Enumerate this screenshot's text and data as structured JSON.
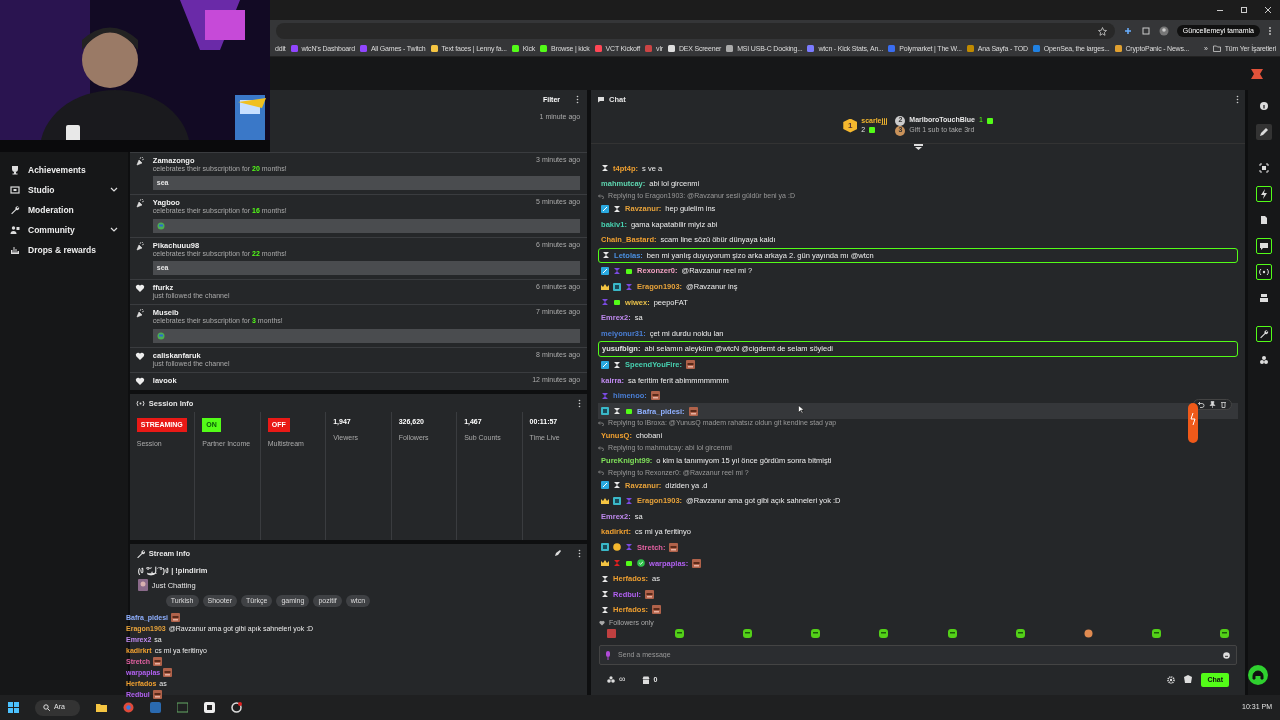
{
  "browser": {
    "update_button": "Güncellemeyi tamamla",
    "bookmarks": [
      "ddit",
      "wtcN's Dashboard",
      "All Games - Twitch",
      "Text faces | Lenny fa...",
      "Kick",
      "Browse | kick",
      "VCT Kickoff",
      "vlr",
      "DEX Screener",
      "MSI USB-C Docking...",
      "wtcn - Kick Stats, An...",
      "Polymarket | The W...",
      "Ana Sayfa - TOD",
      "OpenSea, the larges...",
      "CryptoPanic - News..."
    ],
    "more": "»",
    "all_bookmarks": "Tüm Yer İşaretleri"
  },
  "sidebar": {
    "items": [
      {
        "label": "Achievements",
        "kind": "trophy",
        "expandable": false
      },
      {
        "label": "Studio",
        "kind": "studio",
        "expandable": true
      },
      {
        "label": "Moderation",
        "kind": "wrench",
        "expandable": false
      },
      {
        "label": "Community",
        "kind": "people",
        "expandable": true
      },
      {
        "label": "Drops & rewards",
        "kind": "drops",
        "expandable": false
      }
    ]
  },
  "activity": {
    "filter": "Filter",
    "items": [
      {
        "kind": "hidden",
        "time": "1 minute ago"
      },
      {
        "kind": "subscription",
        "name": "Zamazongo",
        "message": "celebrates their subscription for",
        "months": "20",
        "suffix": "months!",
        "quote": "sea",
        "time": "3 minutes ago"
      },
      {
        "kind": "subscription",
        "name": "Yagboo",
        "message": "celebrates their subscription for",
        "months": "16",
        "suffix": "months!",
        "quote_emote": true,
        "time": "5 minutes ago"
      },
      {
        "kind": "subscription",
        "name": "Pikachuuu98",
        "message": "celebrates their subscription for",
        "months": "22",
        "suffix": "months!",
        "quote": "sea",
        "time": "6 minutes ago"
      },
      {
        "kind": "follow",
        "name": "ffurkz",
        "message": "just followed the channel",
        "time": "6 minutes ago"
      },
      {
        "kind": "subscription",
        "name": "Museib",
        "message": "celebrates their subscription for",
        "months": "3",
        "suffix": "months!",
        "quote_emote": true,
        "time": "7 minutes ago"
      },
      {
        "kind": "follow",
        "name": "caliskanfaruk",
        "message": "just followed the channel",
        "time": "8 minutes ago"
      },
      {
        "kind": "follow",
        "name": "lavook",
        "time": "12 minutes ago"
      }
    ]
  },
  "session_info": {
    "title": "Session Info",
    "stats": [
      {
        "kind": "status",
        "badge": {
          "text": "STREAMING",
          "kind": "live"
        },
        "label": "Session"
      },
      {
        "kind": "status",
        "badge": {
          "text": "ON",
          "kind": "on"
        },
        "label": "Partner Income"
      },
      {
        "kind": "status",
        "badge": {
          "text": "OFF",
          "kind": "off"
        },
        "label": "Multistream"
      },
      {
        "kind": "stat",
        "value": "1,947",
        "label": "Viewers"
      },
      {
        "kind": "stat",
        "value": "326,620",
        "label": "Followers"
      },
      {
        "kind": "stat",
        "value": "1,467",
        "label": "Sub Counts"
      },
      {
        "kind": "stat",
        "value": "00:11:57",
        "label": "Time Live"
      }
    ]
  },
  "stream_info": {
    "title": "Stream Info",
    "stream_title": "(ง ͠° ͟ل͜ ͡°)ง | !pindirim",
    "category": "Just Chatting",
    "tags": [
      "Turkish",
      "Shooter",
      "Türkçe",
      "gaming",
      "pozitif",
      "wtcn"
    ]
  },
  "overlay_chat": [
    {
      "name": "Bafra_pidesi",
      "color": "#8fb0ff",
      "emote": true
    },
    {
      "name": "Eragon1903",
      "color": "#e8a33a",
      "text": "@Ravzanur ama got gibi apık sahneleri yok :D"
    },
    {
      "name": "Emrex2",
      "color": "#c08af0",
      "text": "sa"
    },
    {
      "name": "kadirkrt",
      "color": "#f0a030",
      "text": "cs mi ya feritinyo"
    },
    {
      "name": "Stretch",
      "color": "#e060a0",
      "emote": true
    },
    {
      "name": "warpaplas",
      "color": "#b060f0",
      "emote": true
    },
    {
      "name": "Herfados",
      "color": "#f0a030",
      "text": "as"
    },
    {
      "name": "Redbul",
      "color": "#b060f0",
      "emote": true
    }
  ],
  "chat": {
    "title": "Chat",
    "leaderboard": [
      {
        "kind": "first",
        "rank": "1",
        "name": "scarlejjj",
        "count": "2"
      },
      {
        "kind": "runner",
        "rank": "2",
        "name": "MarlboroTouchBlue",
        "count": "1"
      }
    ],
    "leaderboard_hint": {
      "rank": "3",
      "text": "Gift 1 sub to take 3rd"
    },
    "messages": [
      {
        "badges": [
          {
            "kind": "subscriber"
          }
        ],
        "name": "t4pt4p:",
        "color": "#f0a030",
        "text": "s ve a"
      },
      {
        "name": "mahmutcay:",
        "color": "#5fd6b0",
        "text": "abi lol gircenmi"
      },
      {
        "reply": "Replying to Eragon1903: @Ravzanur sesli güldür beni ya :D",
        "badges": [
          {
            "kind": "moderator"
          },
          {
            "kind": "subscriber"
          }
        ],
        "name": "Ravzanur:",
        "color": "#e8a33a",
        "text": "hep gulelim ins"
      },
      {
        "name": "bakiv1:",
        "color": "#47d1b0",
        "text": "gama kapatabilir miyiz abi"
      },
      {
        "name": "Chain_Bastard:",
        "color": "#f0a030",
        "text": "scam line sözü öbür dünyaya kaldı"
      },
      {
        "highlighted": true,
        "badges": [
          {
            "kind": "subscriber"
          }
        ],
        "name": "Letolas:",
        "color": "#4a90e2",
        "text": "ben mi yanlış duyuyorum şizo arka arkaya 2. gün yayında mı @wtcn"
      },
      {
        "badges": [
          {
            "kind": "moderator"
          },
          {
            "kind": "tier2"
          },
          {
            "kind": "gifter"
          }
        ],
        "name": "Rexonzer0:",
        "color": "#f0a0c0",
        "text": "@Ravzanur reel mi ?"
      },
      {
        "badges": [
          {
            "kind": "founder"
          },
          {
            "kind": "vip"
          },
          {
            "kind": "tier2"
          }
        ],
        "name": "Eragon1903:",
        "color": "#e8a33a",
        "text": "@Ravzanur inş"
      },
      {
        "badges": [
          {
            "kind": "tier2"
          },
          {
            "kind": "gifter"
          }
        ],
        "name": "wiwex:",
        "color": "#e8c04a",
        "text": "peepoFAT"
      },
      {
        "name": "Emrex2:",
        "color": "#c08af0",
        "text": "sa"
      },
      {
        "name": "meiyonur31:",
        "color": "#4a7fd6",
        "text": "çet mi durdu noldu lan"
      },
      {
        "highlighted": true,
        "name": "yusufblgn:",
        "color": "#e0e0e0",
        "text": "abi selamın aleyküm @wtcN @cigdemt de selam söyledi"
      },
      {
        "badges": [
          {
            "kind": "moderator"
          },
          {
            "kind": "subscriber"
          }
        ],
        "name": "SpeendYouFire:",
        "color": "#47d1b0",
        "emote": true
      },
      {
        "name": "kairra:",
        "color": "#c08af0",
        "text": "sa feritim ferit abimmmmmmm"
      },
      {
        "badges": [
          {
            "kind": "tier2"
          }
        ],
        "name": "himenoo:",
        "color": "#4a7fd6",
        "emote": true
      },
      {
        "hovered": true,
        "badges": [
          {
            "kind": "vip"
          },
          {
            "kind": "subscriber"
          },
          {
            "kind": "gifter"
          }
        ],
        "name": "Bafra_pidesi:",
        "color": "#8fb0ff",
        "emote": true
      },
      {
        "reply": "Replying to lBroxa: @YunusQ madem rahatsız oldun git kendine stad yap",
        "name": "YunusQ:",
        "color": "#f0a030",
        "text": "chobani"
      },
      {
        "reply": "Replying to mahmutcay: abi lol gircenmi",
        "name": "PureKnight99:",
        "color": "#7fe05a",
        "text": "o kim la tanımıyom 15 yıl önce gördüm sonra bitmişti"
      },
      {
        "reply": "Replying to Rexonzer0: @Ravzanur reel mi ?",
        "badges": [
          {
            "kind": "moderator"
          },
          {
            "kind": "subscriber"
          }
        ],
        "name": "Ravzanur:",
        "color": "#e8a33a",
        "text": "diziden ya .d"
      },
      {
        "badges": [
          {
            "kind": "founder"
          },
          {
            "kind": "vip"
          },
          {
            "kind": "tier2"
          }
        ],
        "name": "Eragon1903:",
        "color": "#e8a33a",
        "text": "@Ravzanur ama got gibi açık sahneleri yok :D"
      },
      {
        "name": "Emrex2:",
        "color": "#c08af0",
        "text": "sa"
      },
      {
        "name": "kadirkrt:",
        "color": "#f0a030",
        "text": "cs mi ya feritinyo"
      },
      {
        "badges": [
          {
            "kind": "vip"
          },
          {
            "kind": "coin"
          },
          {
            "kind": "tier2"
          }
        ],
        "name": "Stretch:",
        "color": "#e060a0",
        "emote": true
      },
      {
        "badges": [
          {
            "kind": "founder"
          },
          {
            "kind": "tier3"
          },
          {
            "kind": "gifter"
          },
          {
            "kind": "verified"
          }
        ],
        "name": "warpaplas:",
        "color": "#b060f0",
        "emote": true
      },
      {
        "badges": [
          {
            "kind": "subscriber"
          }
        ],
        "name": "Herfados:",
        "color": "#f0a030",
        "text": "as"
      },
      {
        "badges": [
          {
            "kind": "subscriber"
          }
        ],
        "name": "Redbul:",
        "color": "#b060f0",
        "emote": true
      },
      {
        "badges": [
          {
            "kind": "subscriber"
          }
        ],
        "name": "Herfados:",
        "color": "#f0a030",
        "emote": true
      }
    ],
    "followers_only": "Followers only",
    "input": {
      "placeholder": "Send a message"
    },
    "points": "∞",
    "store_count": "0",
    "send_button": "Chat"
  },
  "rail": [
    {
      "kind": "info",
      "selected": false,
      "highlighted": false
    },
    {
      "kind": "edit",
      "selected": true,
      "highlighted": false
    },
    {
      "kind": "screen",
      "selected": false,
      "highlighted": false
    },
    {
      "kind": "bolt",
      "selected": false,
      "highlighted": true
    },
    {
      "kind": "notes",
      "selected": false,
      "highlighted": false
    },
    {
      "kind": "chat",
      "selected": false,
      "highlighted": true
    },
    {
      "kind": "broadcast",
      "selected": false,
      "highlighted": true
    },
    {
      "kind": "layout",
      "selected": false,
      "highlighted": false
    },
    {
      "kind": "tools",
      "selected": false,
      "highlighted": true
    },
    {
      "kind": "nodes",
      "selected": false,
      "highlighted": false
    }
  ],
  "taskbar": {
    "search": "Ara",
    "clock": "10:31 PM"
  }
}
